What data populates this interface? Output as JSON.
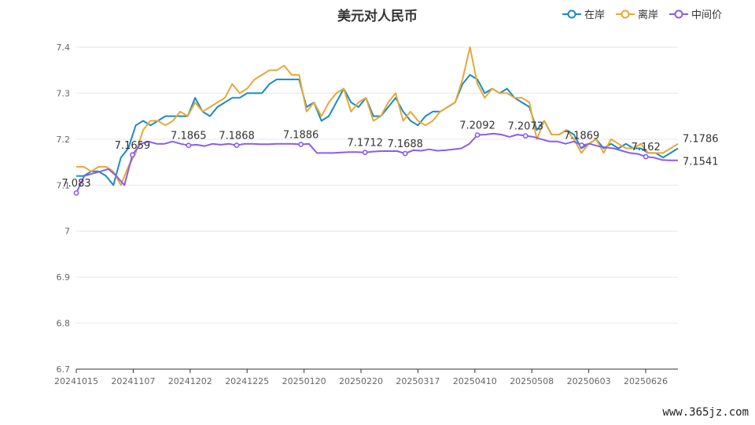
{
  "title": "美元对人民币",
  "watermark": "www.365jz.com",
  "chart_data": {
    "type": "line",
    "title": "美元对人民币",
    "ylim": [
      6.7,
      7.4
    ],
    "y_ticks": [
      "6.7",
      "6.8",
      "6.9",
      "7",
      "7.1",
      "7.2",
      "7.3",
      "7.4"
    ],
    "x_tick_labels": [
      "20241015",
      "20241107",
      "20241202",
      "20241225",
      "20250120",
      "20250220",
      "20250317",
      "20250410",
      "20250508",
      "20250603",
      "20250626"
    ],
    "grid": true,
    "legend_position": "top-right",
    "series": [
      {
        "name": "在岸",
        "color": "#1a8bc4",
        "values": [
          7.12,
          7.12,
          7.13,
          7.13,
          7.12,
          7.1,
          7.16,
          7.18,
          7.23,
          7.24,
          7.23,
          7.24,
          7.25,
          7.25,
          7.25,
          7.25,
          7.29,
          7.26,
          7.25,
          7.27,
          7.28,
          7.29,
          7.29,
          7.3,
          7.3,
          7.3,
          7.32,
          7.33,
          7.33,
          7.33,
          7.33,
          7.27,
          7.28,
          7.24,
          7.25,
          7.28,
          7.31,
          7.28,
          7.27,
          7.29,
          7.25,
          7.25,
          7.27,
          7.29,
          7.26,
          7.24,
          7.23,
          7.25,
          7.26,
          7.26,
          7.27,
          7.28,
          7.32,
          7.34,
          7.33,
          7.3,
          7.31,
          7.3,
          7.31,
          7.29,
          7.28,
          7.27,
          7.22,
          7.24,
          7.21,
          7.21,
          7.22,
          7.21,
          7.18,
          7.19,
          7.2,
          7.18,
          7.19,
          7.18,
          7.19,
          7.18,
          7.18,
          7.17,
          7.17,
          7.16,
          7.17,
          7.18
        ]
      },
      {
        "name": "离岸",
        "color": "#e8a838",
        "values": [
          7.14,
          7.14,
          7.13,
          7.14,
          7.14,
          7.13,
          7.1,
          7.14,
          7.17,
          7.22,
          7.24,
          7.24,
          7.23,
          7.24,
          7.26,
          7.25,
          7.28,
          7.26,
          7.27,
          7.28,
          7.29,
          7.32,
          7.3,
          7.31,
          7.33,
          7.34,
          7.35,
          7.35,
          7.36,
          7.34,
          7.34,
          7.26,
          7.28,
          7.25,
          7.28,
          7.3,
          7.31,
          7.26,
          7.28,
          7.29,
          7.24,
          7.25,
          7.28,
          7.3,
          7.24,
          7.26,
          7.24,
          7.23,
          7.24,
          7.26,
          7.27,
          7.28,
          7.33,
          7.4,
          7.32,
          7.29,
          7.31,
          7.3,
          7.3,
          7.29,
          7.29,
          7.28,
          7.2,
          7.24,
          7.21,
          7.21,
          7.22,
          7.2,
          7.17,
          7.19,
          7.2,
          7.17,
          7.2,
          7.19,
          7.18,
          7.18,
          7.19,
          7.17,
          7.17,
          7.17,
          7.18,
          7.19
        ]
      },
      {
        "name": "中间价",
        "color": "#8a5cf0",
        "values": [
          7.083,
          7.12,
          7.125,
          7.13,
          7.135,
          7.12,
          7.1,
          7.1659,
          7.19,
          7.195,
          7.19,
          7.19,
          7.195,
          7.19,
          7.1865,
          7.188,
          7.185,
          7.19,
          7.188,
          7.19,
          7.1868,
          7.19,
          7.19,
          7.189,
          7.189,
          7.19,
          7.19,
          7.19,
          7.1886,
          7.19,
          7.17,
          7.17,
          7.17,
          7.171,
          7.172,
          7.172,
          7.1712,
          7.173,
          7.174,
          7.174,
          7.174,
          7.1688,
          7.176,
          7.175,
          7.178,
          7.175,
          7.176,
          7.178,
          7.18,
          7.19,
          7.2092,
          7.21,
          7.212,
          7.21,
          7.205,
          7.21,
          7.2073,
          7.205,
          7.2,
          7.195,
          7.195,
          7.19,
          7.195,
          7.1869,
          7.19,
          7.185,
          7.182,
          7.18,
          7.175,
          7.17,
          7.168,
          7.162,
          7.16,
          7.155,
          7.154,
          7.1541
        ]
      }
    ],
    "point_labels": [
      {
        "series": "中间价",
        "index": 0,
        "text": "7.083"
      },
      {
        "series": "中间价",
        "index": 7,
        "text": "7.1659"
      },
      {
        "series": "中间价",
        "index": 14,
        "text": "7.1865"
      },
      {
        "series": "中间价",
        "index": 20,
        "text": "7.1868"
      },
      {
        "series": "中间价",
        "index": 28,
        "text": "7.1886"
      },
      {
        "series": "中间价",
        "index": 36,
        "text": "7.1712"
      },
      {
        "series": "中间价",
        "index": 41,
        "text": "7.1688"
      },
      {
        "series": "中间价",
        "index": 50,
        "text": "7.2092"
      },
      {
        "series": "中间价",
        "index": 56,
        "text": "7.2073"
      },
      {
        "series": "中间价",
        "index": 63,
        "text": "7.1869"
      },
      {
        "series": "中间价",
        "index": 71,
        "text": "7.162"
      }
    ],
    "end_labels": [
      {
        "series": "离岸",
        "text": "7.1786"
      },
      {
        "series": "中间价",
        "text": "7.1541"
      }
    ]
  }
}
